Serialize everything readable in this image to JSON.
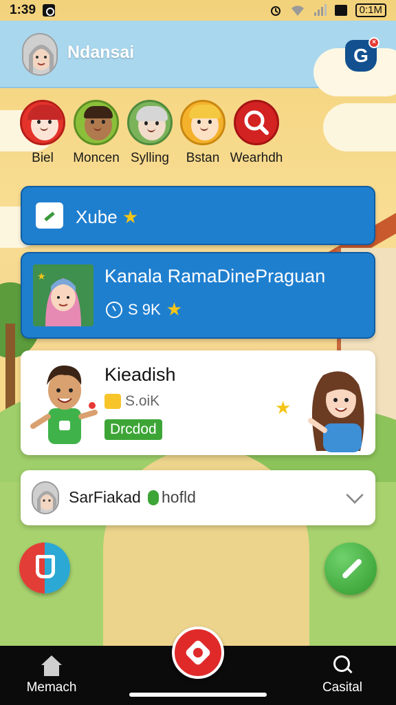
{
  "status": {
    "time": "1:39",
    "battery": "0:1M"
  },
  "header": {
    "title": "Ndansai",
    "badge_letter": "G"
  },
  "stories": [
    {
      "label": "Biel",
      "ring": "#d8372b",
      "bg": "#e4332b",
      "skin": "#fbe4d6",
      "hair": "#c62828"
    },
    {
      "label": "Moncen",
      "ring": "#6aa338",
      "bg": "#8bbf3a",
      "skin": "#b07a4e",
      "hair": "#3b2416"
    },
    {
      "label": "Sylling",
      "ring": "#5e9c4c",
      "bg": "#7bb35a",
      "skin": "#f0dcc8",
      "hair": "#d6d6d6"
    },
    {
      "label": "Bstan",
      "ring": "#e3a61b",
      "bg": "#f4b22c",
      "skin": "#fde1c4",
      "hair": "#f5c842"
    },
    {
      "label": "Wearhdh",
      "ring": "#d32222",
      "bg": "#d32222",
      "skin": "",
      "hair": ""
    }
  ],
  "cards": {
    "xube": {
      "label": "Xube"
    },
    "kanala": {
      "title": "Kanala RamaDinePraguan",
      "meta": "S 9K"
    },
    "kieadish": {
      "title": "Kieadish",
      "meta": "S.oiK",
      "badge": "Drcdod"
    },
    "sarfiakad": {
      "label": "SarFiakad",
      "tag": "hofld"
    }
  },
  "nav": {
    "left_label": "Memach",
    "right_label": "Casital"
  }
}
